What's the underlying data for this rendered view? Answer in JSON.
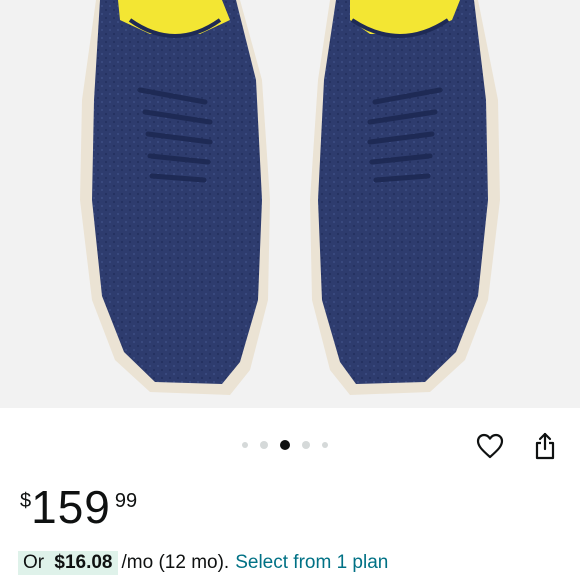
{
  "product": {
    "image_alt": "Navy knit oxford shoes, top view",
    "colors": {
      "knit": "#2e3c6e",
      "sole": "#ebe3d4",
      "lining": "#f3e633"
    }
  },
  "gallery": {
    "total": 5,
    "active_index": 2
  },
  "actions": {
    "wishlist_icon": "heart-icon",
    "share_icon": "share-icon"
  },
  "price": {
    "symbol": "$",
    "whole": "159",
    "fraction": "99"
  },
  "installment": {
    "prefix": "Or",
    "amount": "$16.08",
    "terms": "/mo (12 mo).",
    "link_text": "Select from 1 plan"
  },
  "colors": {
    "link": "#007185",
    "highlight": "#dff2ea",
    "text": "#0f1111"
  }
}
